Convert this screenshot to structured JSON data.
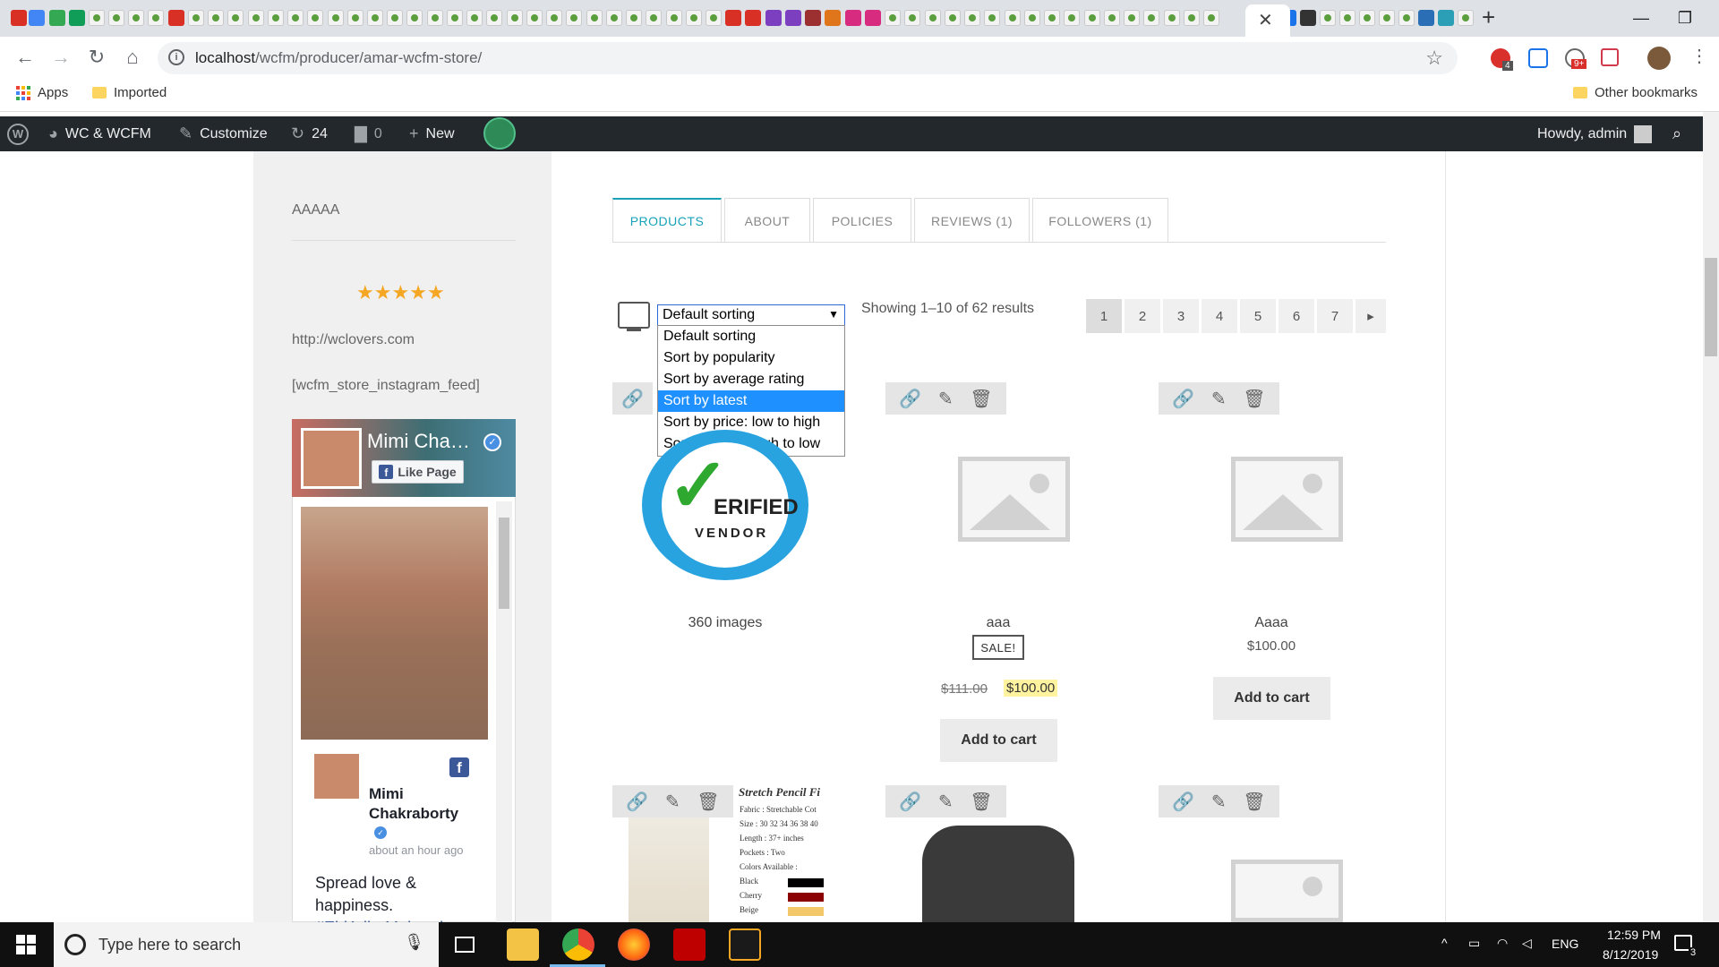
{
  "browser": {
    "url_host": "localhost",
    "url_path": "/wcfm/producer/amar-wcfm-store/",
    "bookmarks": [
      {
        "label": "Apps"
      },
      {
        "label": "Imported"
      }
    ],
    "other_bookmarks": "Other bookmarks",
    "extension_badges": {
      "abp": "4",
      "second": "9+"
    }
  },
  "adminbar": {
    "site_name": "WC & WCFM",
    "customize": "Customize",
    "updates_count": "24",
    "comments_count": "0",
    "new_label": "New",
    "howdy": "Howdy, admin"
  },
  "sidebar": {
    "store_name": "AAAAA",
    "rating": 5,
    "website": "http://wclovers.com",
    "instagram_shortcode": "[wcfm_store_instagram_feed]",
    "fb": {
      "cover_name": "Mimi Cha…",
      "like_label": "Like Page",
      "post_author_line1": "Mimi",
      "post_author_line2": "Chakraborty",
      "post_time": "about an hour ago",
      "post_text_line1": "Spread love &",
      "post_text_line2": "happiness.",
      "post_tag": "#EidAdhaMubarak"
    }
  },
  "tabs": [
    {
      "label": "PRODUCTS"
    },
    {
      "label": "ABOUT"
    },
    {
      "label": "POLICIES"
    },
    {
      "label": "REVIEWS (1)"
    },
    {
      "label": "FOLLOWERS (1)"
    }
  ],
  "sorting": {
    "selected": "Default sorting",
    "options": [
      "Default sorting",
      "Sort by popularity",
      "Sort by average rating",
      "Sort by latest",
      "Sort by price: low to high",
      "Sort by price: high to low"
    ],
    "highlighted_index": 3
  },
  "results_text": "Showing 1–10 of 62 results",
  "pagination": [
    "1",
    "2",
    "3",
    "4",
    "5",
    "6",
    "7"
  ],
  "products": [
    {
      "name": "360 images",
      "badge_text": "ERIFIED",
      "badge_sub": "VENDOR"
    },
    {
      "name": "aaa",
      "sale": "SALE!",
      "old_price": "$111.00",
      "price": "$100.00",
      "button": "Add to cart"
    },
    {
      "name": "Aaaa",
      "price": "$100.00",
      "button": "Add to cart"
    }
  ],
  "pencil_fit_image": {
    "title": "Stretch Pencil Fi",
    "lines": [
      "Fabric : Stretchable Cot",
      "Size : 30 32 34 36 38 40",
      "Length : 37+ inches",
      "Pockets : Two",
      "Colors Available :",
      "Black",
      "Cherry",
      "Beige"
    ]
  },
  "taskbar": {
    "search_placeholder": "Type here to search",
    "lang": "ENG",
    "time": "12:59 PM",
    "date": "8/12/2019",
    "notif_count": "3"
  },
  "colors": {
    "accent": "#17a2b8",
    "adminbar": "#23282d",
    "star": "#f5a623",
    "select_highlight": "#1e90ff",
    "price_highlight": "#fff3a0"
  }
}
